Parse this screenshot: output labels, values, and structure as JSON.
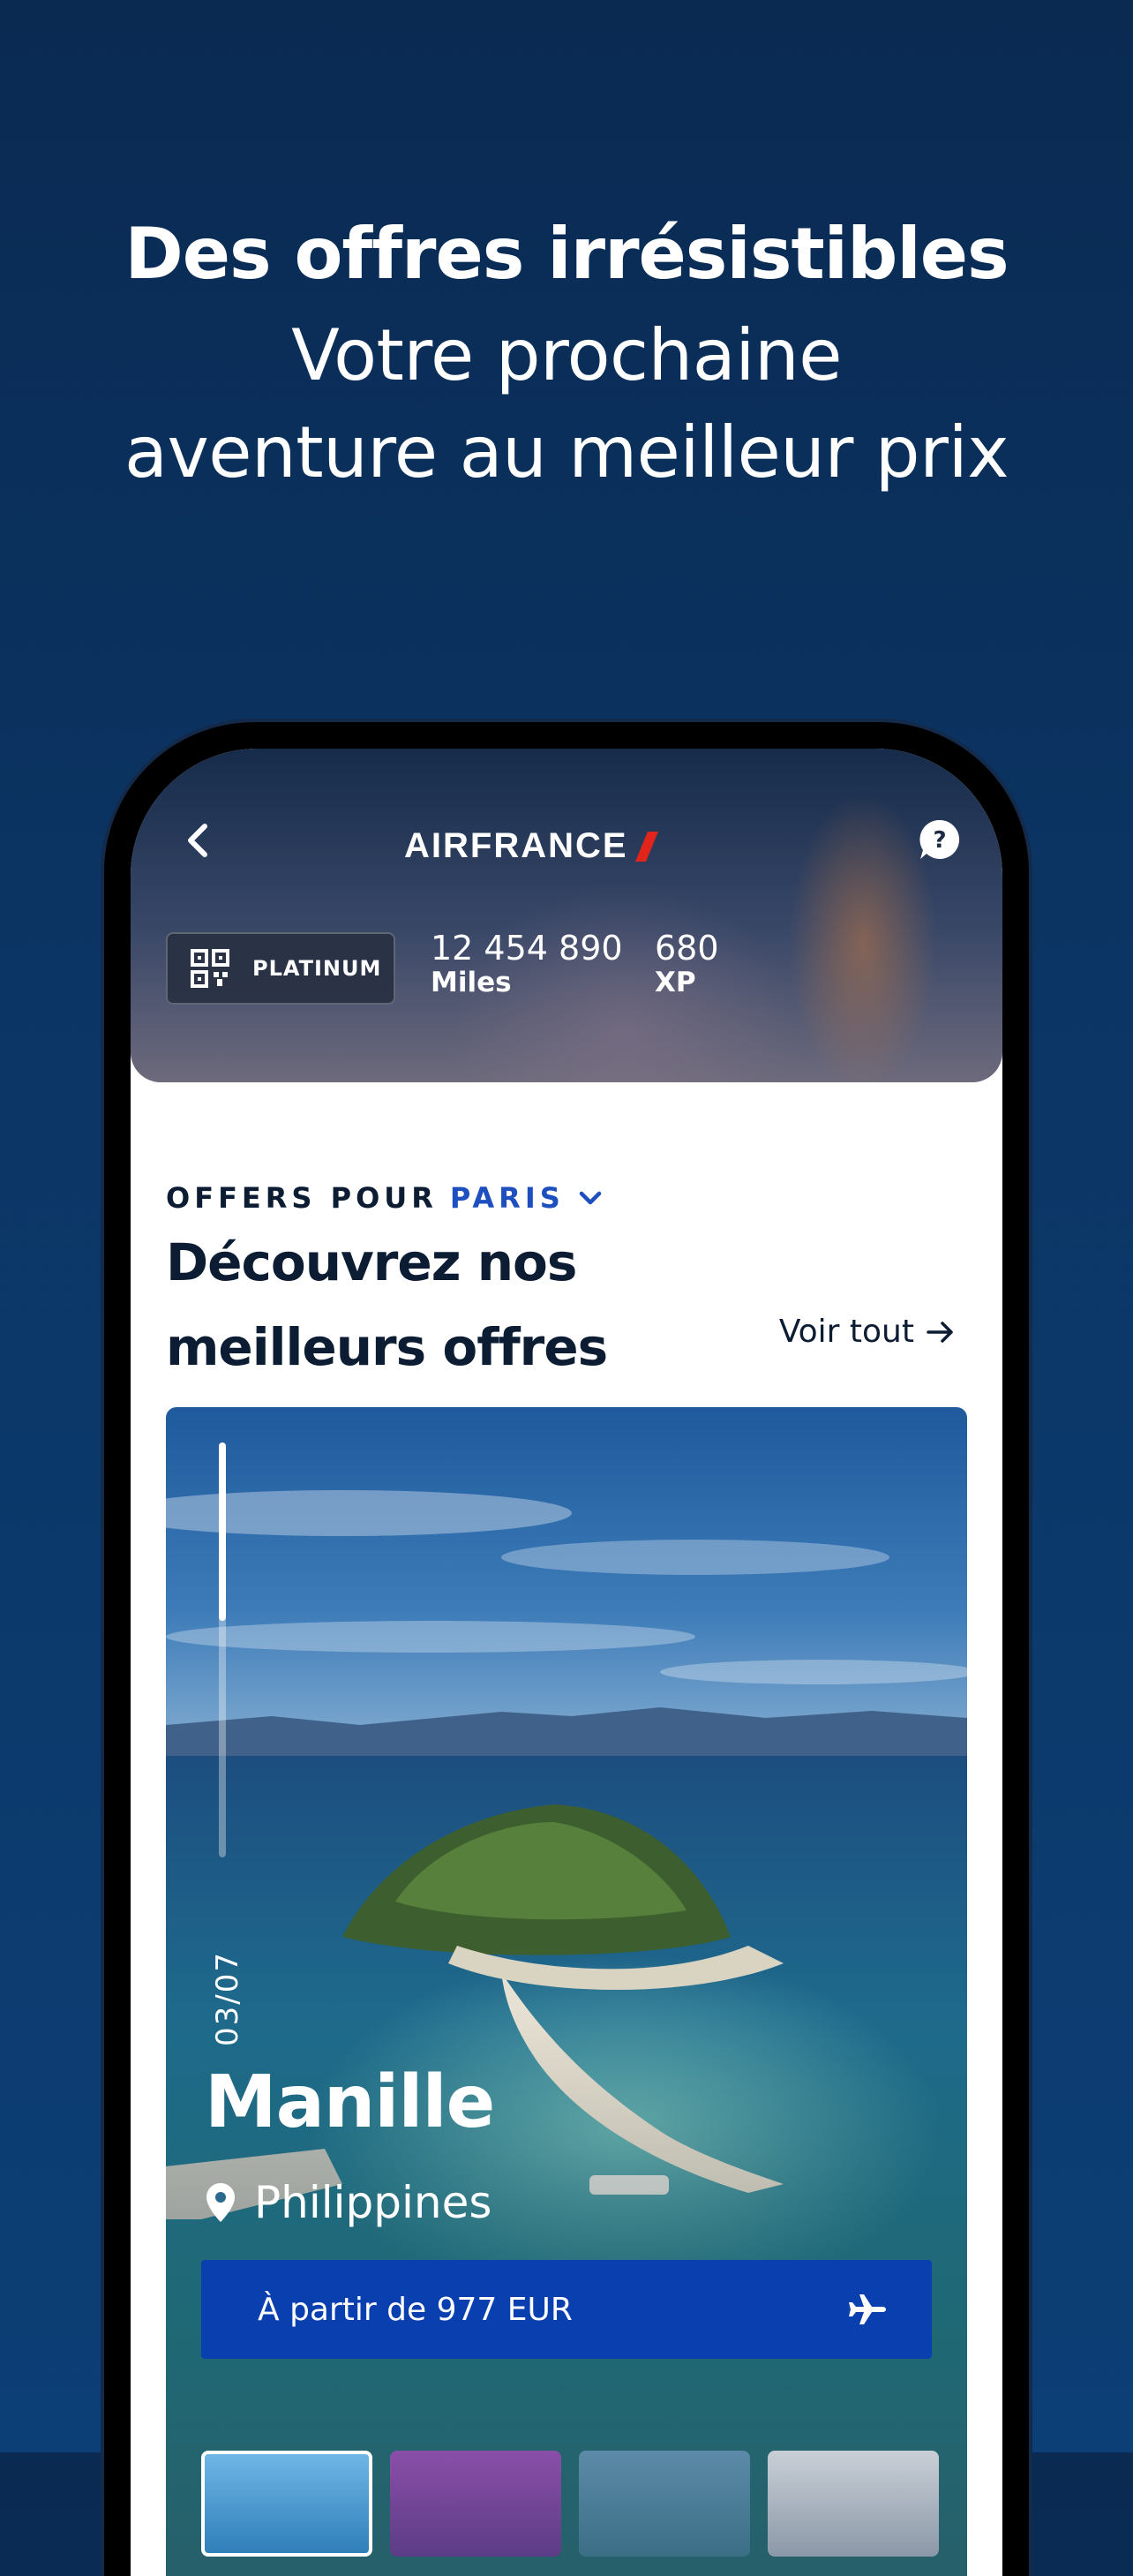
{
  "hero": {
    "title": "Des offres irrésistibles",
    "subtitle_line1": "Votre prochaine",
    "subtitle_line2": "aventure au meilleur prix"
  },
  "app_header": {
    "logo": "AIRFRANCE",
    "tier": "PLATINUM",
    "miles_value": "12 454 890",
    "miles_label": "Miles",
    "xp_value": "680",
    "xp_label": "XP",
    "back_icon": "chevron-left-icon",
    "help_icon": "help-chat-icon"
  },
  "offers": {
    "prefix": "OFFERS POUR",
    "city": "PARIS",
    "title": "Découvrez nos meilleurs offres",
    "see_all": "Voir tout"
  },
  "destination": {
    "counter": "03/07",
    "city": "Manille",
    "country": "Philippines",
    "price_label": "À partir de 977 EUR",
    "slide_progress": 0.43
  },
  "colors": {
    "background": "#0b3564",
    "accent_blue": "#0a3fb0",
    "brand_red": "#e1251b",
    "text_dark": "#0b1c33"
  }
}
